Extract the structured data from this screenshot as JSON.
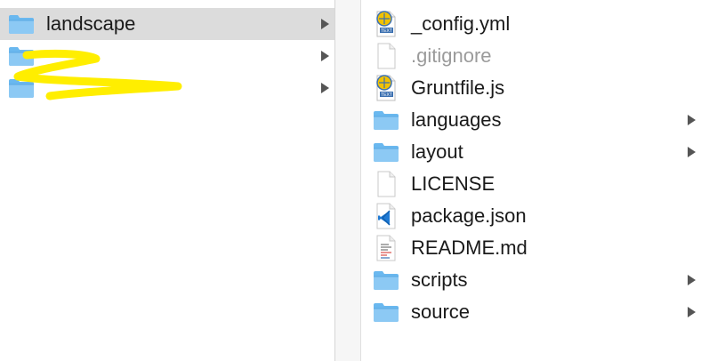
{
  "colors": {
    "selected_row": "#dcdcdc",
    "folder": "#6ab8ef",
    "redaction": "#ffee00"
  },
  "column_left": {
    "items": [
      {
        "label": "landscape",
        "icon": "folder-icon",
        "selected": true,
        "has_children": true
      },
      {
        "label": "",
        "icon": "folder-icon",
        "selected": false,
        "has_children": true,
        "redacted": true
      },
      {
        "label": "",
        "icon": "folder-icon",
        "selected": false,
        "has_children": true,
        "redacted": true
      }
    ]
  },
  "column_right": {
    "items": [
      {
        "label": "_config.yml",
        "icon": "text-document-icon",
        "has_children": false
      },
      {
        "label": ".gitignore",
        "icon": "blank-document-icon",
        "has_children": false,
        "dimmed": true
      },
      {
        "label": "Gruntfile.js",
        "icon": "text-document-icon",
        "has_children": false
      },
      {
        "label": "languages",
        "icon": "folder-icon",
        "has_children": true
      },
      {
        "label": "layout",
        "icon": "folder-icon",
        "has_children": true
      },
      {
        "label": "LICENSE",
        "icon": "blank-document-icon",
        "has_children": false
      },
      {
        "label": "package.json",
        "icon": "vscode-document-icon",
        "has_children": false
      },
      {
        "label": "README.md",
        "icon": "markdown-document-icon",
        "has_children": false
      },
      {
        "label": "scripts",
        "icon": "folder-icon",
        "has_children": true
      },
      {
        "label": "source",
        "icon": "folder-icon",
        "has_children": true
      }
    ]
  }
}
